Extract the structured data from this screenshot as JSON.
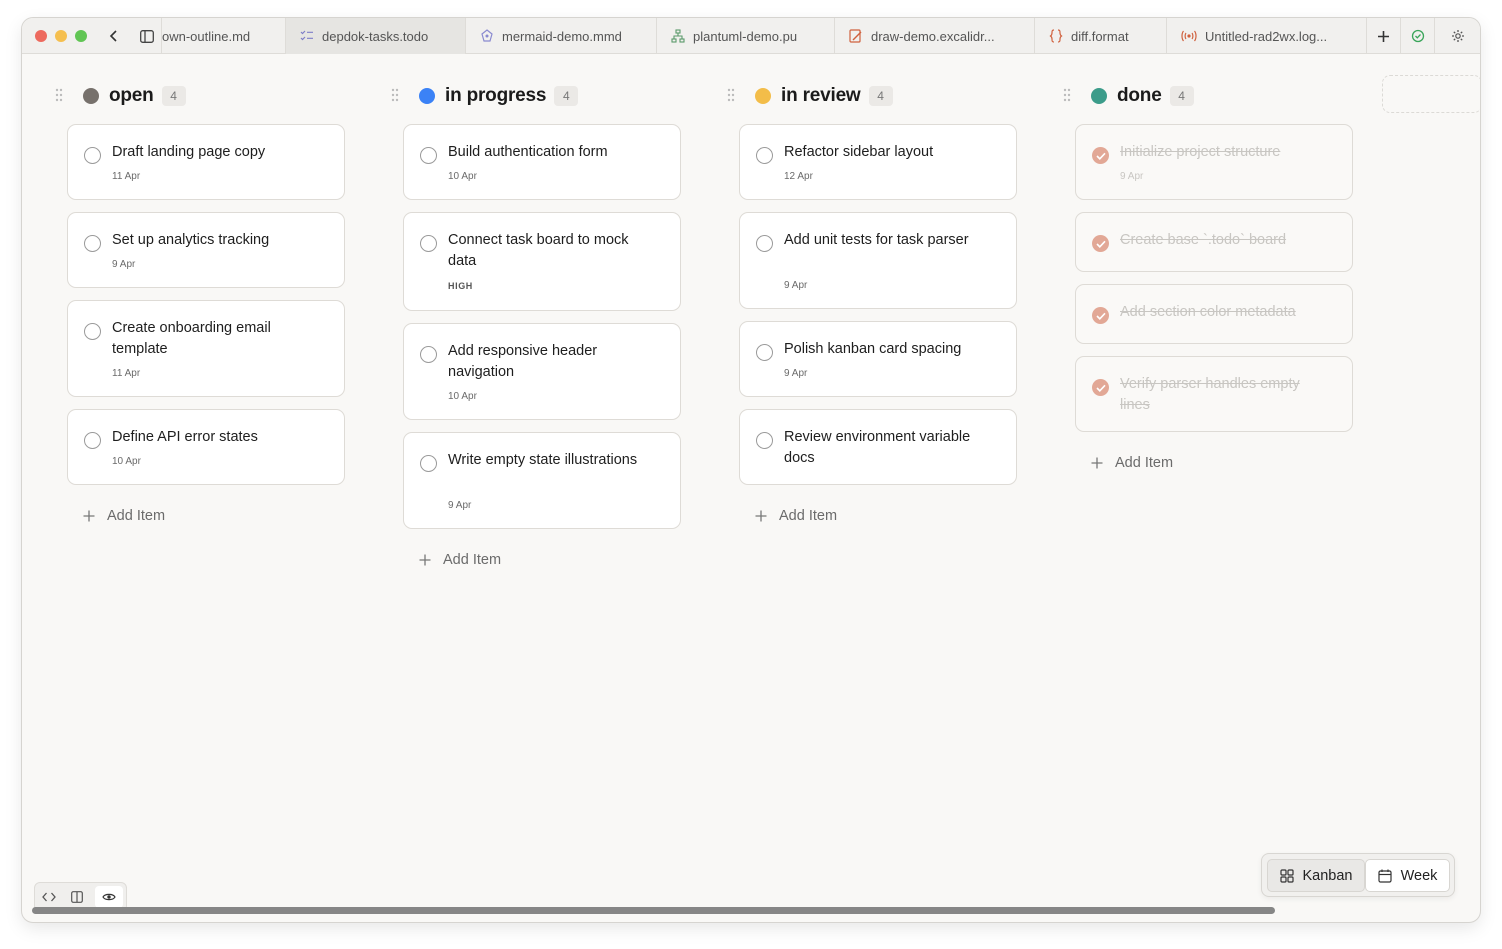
{
  "tabs": [
    {
      "label": "own-outline.md",
      "icon": "none"
    },
    {
      "label": "depdok-tasks.todo",
      "icon": "checklist-icon",
      "active": true
    },
    {
      "label": "mermaid-demo.mmd",
      "icon": "diagram-icon"
    },
    {
      "label": "plantuml-demo.pu",
      "icon": "hierarchy-icon"
    },
    {
      "label": "draw-demo.excalidr...",
      "icon": "drawing-icon"
    },
    {
      "label": "diff.format",
      "icon": "braces-icon"
    },
    {
      "label": "Untitled-rad2wx.log...",
      "icon": "broadcast-icon"
    }
  ],
  "colors": {
    "open": "#77716c",
    "in_progress": "#3b82f6",
    "in_review": "#f3bd49",
    "done": "#3c9c8a",
    "checked": "#e2a896"
  },
  "columns": [
    {
      "title": "open",
      "count": "4",
      "cards": [
        {
          "title": "Draft landing page copy",
          "date": "11 Apr"
        },
        {
          "title": "Set up analytics tracking",
          "date": "9 Apr"
        },
        {
          "title": "Create onboarding email template",
          "date": "11 Apr"
        },
        {
          "title": "Define API error states",
          "date": "10 Apr"
        }
      ],
      "add_label": "Add Item"
    },
    {
      "title": "in progress",
      "count": "4",
      "cards": [
        {
          "title": "Build authentication form",
          "date": "10 Apr"
        },
        {
          "title": "Connect task board to mock data",
          "badge": "HIGH"
        },
        {
          "title": "Add responsive header navigation",
          "date": "10 Apr"
        },
        {
          "title": "Write empty state illustrations",
          "date": "9 Apr"
        }
      ],
      "add_label": "Add Item"
    },
    {
      "title": "in review",
      "count": "4",
      "cards": [
        {
          "title": "Refactor sidebar layout",
          "date": "12 Apr"
        },
        {
          "title": "Add unit tests for task parser",
          "date": "9 Apr"
        },
        {
          "title": "Polish kanban card spacing",
          "date": "9 Apr"
        },
        {
          "title": "Review environment variable docs"
        }
      ],
      "add_label": "Add Item"
    },
    {
      "title": "done",
      "count": "4",
      "cards": [
        {
          "title": "Initialize project structure",
          "date": "9 Apr"
        },
        {
          "title": "Create base `.todo` board"
        },
        {
          "title": "Add section color metadata"
        },
        {
          "title": "Verify parser handles empty lines"
        }
      ],
      "add_label": "Add Item"
    }
  ],
  "view_toggle": {
    "kanban": "Kanban",
    "week": "Week"
  }
}
